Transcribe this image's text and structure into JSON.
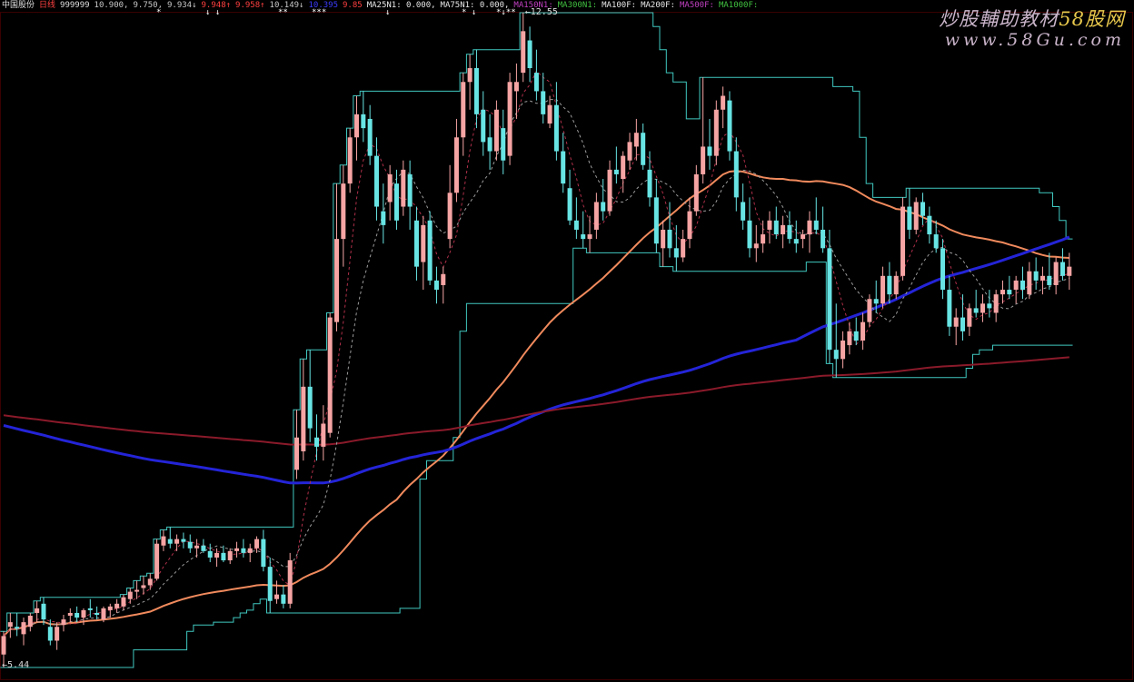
{
  "header": {
    "stock": "中国股份",
    "period": "日线",
    "code": "999999",
    "values": [
      {
        "text": "10.900,",
        "color": "#c8c8c8"
      },
      {
        "text": "9.750,",
        "color": "#c8c8c8"
      },
      {
        "text": "9.934↓",
        "color": "#c8c8c8"
      },
      {
        "text": "9.948↑",
        "color": "#ff4040"
      },
      {
        "text": "9.958↑",
        "color": "#ff4040"
      },
      {
        "text": "10.149↓",
        "color": "#c8c8c8"
      },
      {
        "text": "10.395",
        "color": "#3c3cff"
      },
      {
        "text": "9.85",
        "color": "#ff4040"
      },
      {
        "text": "MA25N1: 0.000,",
        "color": "#e8e8e8"
      },
      {
        "text": "MA75N1: 0.000,",
        "color": "#e8e8e8"
      },
      {
        "text": "MA150N1:",
        "color": "#c040c0"
      },
      {
        "text": "MA300N1:",
        "color": "#40c040"
      },
      {
        "text": "MA100F:",
        "color": "#e8e8e8"
      },
      {
        "text": "MA200F:",
        "color": "#e8e8e8"
      },
      {
        "text": "MA500F:",
        "color": "#c040c0"
      },
      {
        "text": "MA1000F:",
        "color": "#40c040"
      }
    ],
    "marks": [
      "*",
      "↓ ↓",
      "**",
      "***",
      "↓",
      "* ↓",
      "*↓**"
    ]
  },
  "watermark": {
    "line1_prefix": "炒股輔助教材",
    "line1_hot": "58股网",
    "line2": "www.58Gu.com"
  },
  "chart_data": {
    "type": "candlestick",
    "title": "",
    "price_labels": {
      "high": "12.55",
      "low": "5.44"
    },
    "high": 12.55,
    "low": 5.44,
    "ohlc": [
      [
        5.6,
        5.85,
        5.46,
        5.8
      ],
      [
        5.9,
        6.05,
        5.78,
        5.95
      ],
      [
        5.9,
        6.05,
        5.8,
        5.88
      ],
      [
        5.82,
        6.0,
        5.7,
        5.95
      ],
      [
        5.9,
        6.05,
        5.85,
        6.02
      ],
      [
        6.05,
        6.18,
        5.95,
        6.1
      ],
      [
        6.15,
        6.22,
        5.92,
        5.98
      ],
      [
        5.9,
        5.98,
        5.7,
        5.75
      ],
      [
        5.75,
        5.95,
        5.65,
        5.9
      ],
      [
        5.92,
        6.03,
        5.85,
        5.98
      ],
      [
        6.02,
        6.1,
        5.95,
        6.05
      ],
      [
        6.05,
        6.12,
        5.95,
        6.0
      ],
      [
        6.0,
        6.1,
        5.92,
        6.08
      ],
      [
        6.1,
        6.2,
        6.0,
        6.08
      ],
      [
        6.05,
        6.12,
        5.98,
        6.03
      ],
      [
        5.98,
        6.12,
        5.95,
        6.1
      ],
      [
        6.08,
        6.15,
        6.0,
        6.12
      ],
      [
        6.1,
        6.2,
        6.05,
        6.15
      ],
      [
        6.12,
        6.25,
        6.08,
        6.22
      ],
      [
        6.2,
        6.32,
        6.15,
        6.28
      ],
      [
        6.28,
        6.4,
        6.2,
        6.3
      ],
      [
        6.32,
        6.45,
        6.25,
        6.35
      ],
      [
        6.35,
        6.48,
        6.3,
        6.42
      ],
      [
        6.42,
        6.85,
        6.4,
        6.8
      ],
      [
        6.78,
        6.95,
        6.72,
        6.88
      ],
      [
        6.85,
        6.98,
        6.75,
        6.8
      ],
      [
        6.8,
        6.9,
        6.72,
        6.85
      ],
      [
        6.85,
        6.92,
        6.75,
        6.82
      ],
      [
        6.82,
        6.9,
        6.7,
        6.75
      ],
      [
        6.75,
        6.85,
        6.65,
        6.78
      ],
      [
        6.78,
        6.85,
        6.7,
        6.72
      ],
      [
        6.72,
        6.8,
        6.6,
        6.65
      ],
      [
        6.65,
        6.75,
        6.55,
        6.7
      ],
      [
        6.7,
        6.78,
        6.6,
        6.62
      ],
      [
        6.62,
        6.75,
        6.58,
        6.72
      ],
      [
        6.72,
        6.82,
        6.65,
        6.75
      ],
      [
        6.75,
        6.85,
        6.65,
        6.7
      ],
      [
        6.7,
        6.8,
        6.6,
        6.75
      ],
      [
        6.75,
        6.88,
        6.7,
        6.85
      ],
      [
        6.85,
        6.95,
        6.5,
        6.55
      ],
      [
        6.55,
        6.65,
        6.05,
        6.18
      ],
      [
        6.2,
        6.4,
        6.15,
        6.25
      ],
      [
        6.25,
        6.35,
        6.1,
        6.15
      ],
      [
        6.15,
        6.7,
        6.1,
        6.62
      ],
      [
        7.6,
        8.25,
        7.5,
        7.95
      ],
      [
        7.8,
        8.8,
        7.7,
        8.5
      ],
      [
        8.5,
        8.9,
        7.9,
        8.05
      ],
      [
        7.95,
        8.2,
        7.7,
        7.85
      ],
      [
        7.85,
        8.3,
        7.7,
        8.1
      ],
      [
        8.0,
        9.3,
        7.95,
        9.25
      ],
      [
        9.2,
        10.7,
        9.1,
        10.1
      ],
      [
        10.1,
        10.9,
        9.8,
        10.7
      ],
      [
        10.7,
        11.3,
        10.6,
        11.2
      ],
      [
        11.2,
        11.65,
        10.95,
        11.45
      ],
      [
        11.45,
        11.7,
        11.15,
        11.3
      ],
      [
        11.4,
        11.55,
        10.9,
        11.0
      ],
      [
        11.0,
        11.2,
        10.3,
        10.45
      ],
      [
        10.4,
        10.7,
        10.05,
        10.25
      ],
      [
        10.5,
        10.9,
        10.3,
        10.8
      ],
      [
        10.7,
        10.85,
        10.2,
        10.3
      ],
      [
        10.45,
        10.95,
        10.35,
        10.85
      ],
      [
        10.8,
        10.95,
        10.2,
        10.45
      ],
      [
        10.3,
        10.45,
        9.65,
        9.8
      ],
      [
        9.85,
        10.35,
        9.55,
        10.25
      ],
      [
        10.3,
        10.4,
        9.6,
        9.65
      ],
      [
        9.65,
        9.8,
        9.4,
        9.55
      ],
      [
        9.6,
        9.8,
        9.4,
        9.72
      ],
      [
        10.1,
        10.9,
        10.0,
        10.6
      ],
      [
        10.6,
        11.4,
        10.5,
        11.2
      ],
      [
        11.2,
        11.9,
        11.0,
        11.8
      ],
      [
        11.8,
        12.1,
        11.5,
        11.95
      ],
      [
        11.95,
        12.15,
        11.3,
        11.45
      ],
      [
        11.5,
        11.7,
        11.0,
        11.15
      ],
      [
        11.2,
        11.45,
        10.85,
        11.05
      ],
      [
        11.05,
        11.6,
        10.95,
        11.5
      ],
      [
        11.3,
        11.5,
        10.8,
        10.95
      ],
      [
        11.0,
        11.9,
        10.9,
        11.8
      ],
      [
        11.7,
        12.0,
        11.4,
        11.8
      ],
      [
        11.9,
        12.55,
        11.8,
        12.35
      ],
      [
        12.25,
        12.4,
        11.8,
        11.95
      ],
      [
        11.9,
        12.15,
        11.6,
        11.7
      ],
      [
        11.7,
        11.9,
        11.35,
        11.45
      ],
      [
        11.35,
        11.65,
        11.3,
        11.55
      ],
      [
        11.55,
        11.8,
        10.95,
        11.05
      ],
      [
        11.05,
        11.25,
        10.6,
        10.7
      ],
      [
        10.65,
        10.85,
        10.25,
        10.3
      ],
      [
        10.3,
        10.55,
        10.1,
        10.2
      ],
      [
        10.15,
        10.4,
        10.0,
        10.1
      ],
      [
        10.1,
        10.35,
        9.95,
        10.15
      ],
      [
        10.2,
        10.6,
        10.1,
        10.5
      ],
      [
        10.5,
        10.75,
        10.3,
        10.4
      ],
      [
        10.4,
        10.95,
        10.35,
        10.85
      ],
      [
        10.85,
        11.1,
        10.7,
        10.8
      ],
      [
        10.75,
        11.05,
        10.6,
        11.0
      ],
      [
        10.95,
        11.25,
        10.85,
        11.15
      ],
      [
        11.1,
        11.4,
        10.95,
        11.25
      ],
      [
        11.25,
        11.35,
        10.85,
        10.9
      ],
      [
        10.85,
        11.05,
        10.45,
        10.55
      ],
      [
        10.55,
        10.75,
        9.95,
        10.05
      ],
      [
        10.0,
        10.3,
        9.8,
        10.2
      ],
      [
        10.2,
        10.5,
        9.9,
        10.0
      ],
      [
        10.0,
        10.25,
        9.75,
        9.9
      ],
      [
        9.9,
        10.2,
        9.85,
        10.1
      ],
      [
        10.1,
        10.55,
        10.0,
        10.4
      ],
      [
        10.4,
        10.9,
        10.35,
        10.8
      ],
      [
        10.8,
        11.85,
        10.7,
        11.1
      ],
      [
        11.1,
        11.4,
        10.85,
        11.0
      ],
      [
        11.0,
        11.6,
        10.9,
        11.5
      ],
      [
        11.5,
        11.75,
        11.3,
        11.65
      ],
      [
        11.6,
        11.7,
        10.95,
        11.05
      ],
      [
        11.05,
        11.2,
        10.4,
        10.55
      ],
      [
        10.5,
        10.7,
        10.2,
        10.3
      ],
      [
        10.3,
        10.55,
        9.9,
        10.0
      ],
      [
        10.0,
        10.25,
        9.85,
        10.05
      ],
      [
        10.05,
        10.3,
        9.95,
        10.15
      ],
      [
        10.2,
        10.4,
        10.05,
        10.3
      ],
      [
        10.3,
        10.45,
        10.1,
        10.15
      ],
      [
        10.15,
        10.35,
        10.0,
        10.25
      ],
      [
        10.25,
        10.4,
        10.05,
        10.1
      ],
      [
        10.1,
        10.3,
        9.95,
        10.05
      ],
      [
        10.1,
        10.2,
        10.0,
        10.15
      ],
      [
        10.15,
        10.4,
        9.95,
        10.3
      ],
      [
        10.3,
        10.55,
        10.15,
        10.2
      ],
      [
        10.2,
        10.45,
        9.95,
        10.0
      ],
      [
        10.0,
        10.2,
        8.75,
        8.9
      ],
      [
        8.9,
        9.4,
        8.6,
        8.8
      ],
      [
        8.8,
        9.1,
        8.7,
        9.0
      ],
      [
        8.95,
        9.2,
        8.85,
        9.1
      ],
      [
        9.1,
        9.25,
        8.95,
        9.0
      ],
      [
        9.0,
        9.3,
        8.9,
        9.2
      ],
      [
        9.2,
        9.5,
        9.15,
        9.45
      ],
      [
        9.45,
        9.65,
        9.3,
        9.4
      ],
      [
        9.4,
        9.8,
        9.35,
        9.7
      ],
      [
        9.7,
        9.85,
        9.4,
        9.5
      ],
      [
        9.5,
        9.75,
        9.45,
        9.7
      ],
      [
        9.7,
        10.55,
        9.65,
        10.45
      ],
      [
        10.45,
        10.65,
        10.1,
        10.2
      ],
      [
        10.2,
        10.55,
        10.15,
        10.5
      ],
      [
        10.5,
        10.6,
        10.25,
        10.35
      ],
      [
        10.35,
        10.45,
        10.05,
        10.15
      ],
      [
        10.15,
        10.3,
        9.95,
        10.0
      ],
      [
        10.0,
        10.1,
        9.45,
        9.55
      ],
      [
        9.55,
        9.7,
        9.05,
        9.15
      ],
      [
        9.15,
        9.35,
        8.95,
        9.25
      ],
      [
        9.25,
        9.5,
        9.0,
        9.1
      ],
      [
        9.15,
        9.4,
        9.05,
        9.35
      ],
      [
        9.35,
        9.55,
        9.25,
        9.3
      ],
      [
        9.3,
        9.5,
        9.2,
        9.4
      ],
      [
        9.4,
        9.55,
        9.25,
        9.35
      ],
      [
        9.3,
        9.55,
        9.2,
        9.5
      ],
      [
        9.5,
        9.65,
        9.4,
        9.55
      ],
      [
        9.55,
        9.7,
        9.45,
        9.5
      ],
      [
        9.55,
        9.7,
        9.4,
        9.65
      ],
      [
        9.65,
        9.8,
        9.45,
        9.55
      ],
      [
        9.5,
        9.85,
        9.45,
        9.75
      ],
      [
        9.75,
        9.9,
        9.55,
        9.65
      ],
      [
        9.65,
        9.8,
        9.5,
        9.7
      ],
      [
        9.7,
        9.95,
        9.55,
        9.6
      ],
      [
        9.6,
        9.9,
        9.5,
        9.85
      ],
      [
        9.85,
        10.0,
        9.65,
        9.7
      ],
      [
        9.7,
        9.95,
        9.55,
        9.8
      ]
    ],
    "series": [
      {
        "color": "#f08a5d",
        "width": 2,
        "period": 60,
        "dash": ""
      },
      {
        "color": "#2424d8",
        "width": 3,
        "period": 120,
        "dash": ""
      },
      {
        "color": "#8a1a2a",
        "width": 2,
        "period": 250,
        "dash": ""
      },
      {
        "color": "#9b9b9b",
        "width": 1,
        "period": 10,
        "dash": "3,3"
      },
      {
        "color": "#b0304a",
        "width": 1,
        "period": 5,
        "dash": "3,3"
      }
    ],
    "channel": {
      "color": "#40c8c0",
      "lookback": 20
    }
  }
}
